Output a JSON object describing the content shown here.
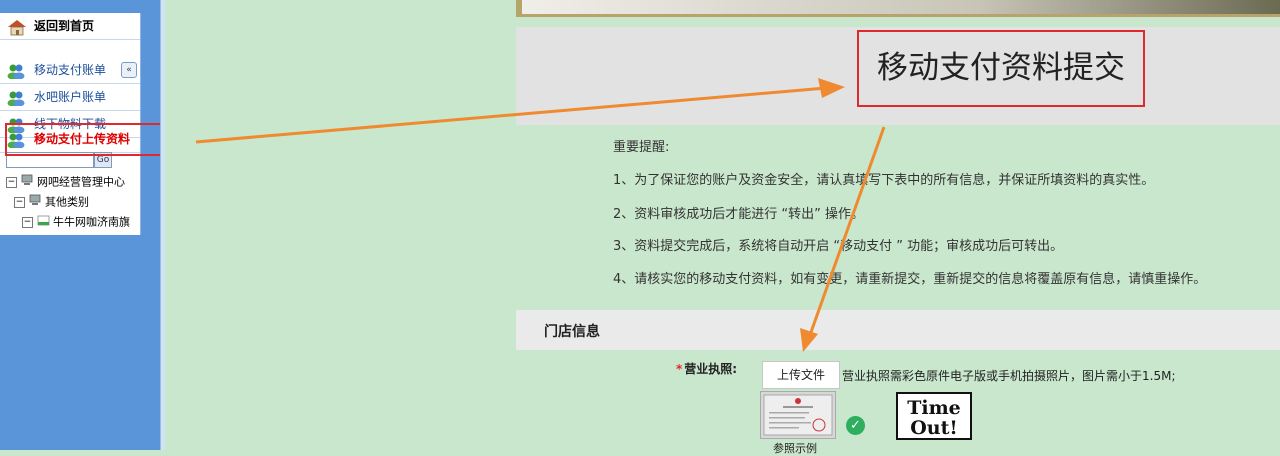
{
  "sidebar": {
    "items": [
      {
        "label": "返回到首页",
        "icon": "house-icon"
      },
      {
        "label": "移动支付账单",
        "icon": "users-icon"
      },
      {
        "label": "水吧账户账单",
        "icon": "users-icon"
      },
      {
        "label": "线下物料下载",
        "icon": "users-icon"
      },
      {
        "label": "移动支付上传资料",
        "icon": "users-icon"
      }
    ],
    "collapse_glyph": "«",
    "search_glyph": "Go"
  },
  "tree": {
    "toggle_glyph": "−",
    "nodes": [
      {
        "label": "网吧经营管理中心"
      },
      {
        "label": "其他类别"
      },
      {
        "label": "牛牛网咖济南旗"
      }
    ]
  },
  "main": {
    "page_title": "移动支付资料提交",
    "notice": {
      "title": "重要提醒:",
      "lines": [
        "1、为了保证您的账户及资金安全，请认真填写下表中的所有信息，并保证所填资料的真实性。",
        "2、资料审核成功后才能进行 “转出” 操作。",
        "3、资料提交完成后，系统将自动开启 “移动支付 ” 功能；审核成功后可转出。",
        "4、请核实您的移动支付资料，如有变更，请重新提交，重新提交的信息将覆盖原有信息，请慎重操作。"
      ]
    },
    "store_section": {
      "title": "门店信息",
      "license_required_mark": "*",
      "license_label": "营业执照:",
      "upload_button": "上传文件",
      "license_hint": "营业执照需彩色原件电子版或手机拍摄照片，图片需小于1.5M;",
      "sample_label": "参照示例",
      "check_glyph": "✓",
      "logo_text_top": "Time",
      "logo_text_bottom": "Out!"
    }
  },
  "colors": {
    "highlight_red": "#e0282f",
    "arrow_orange": "#f08a30",
    "left_blue": "#5b95d9",
    "page_green": "#c9e7cd"
  }
}
